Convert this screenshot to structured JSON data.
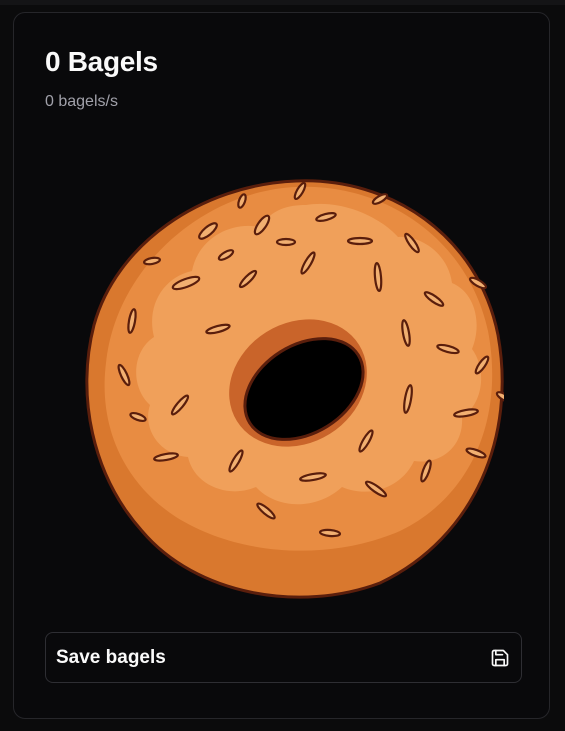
{
  "counter": {
    "title": "0 Bagels",
    "rate": "0 bagels/s"
  },
  "bagel": {
    "icon": "bagel-icon"
  },
  "save": {
    "label": "Save bagels",
    "icon": "save-icon"
  },
  "colors": {
    "background": "#09090b",
    "text": "#fafafa",
    "muted_text": "#a1a1aa",
    "border": "#26262a",
    "bagel_outer": "#d9782e",
    "bagel_top": "#e88c42",
    "bagel_glaze": "#f0a05a",
    "bagel_outline": "#5a1e0c"
  }
}
